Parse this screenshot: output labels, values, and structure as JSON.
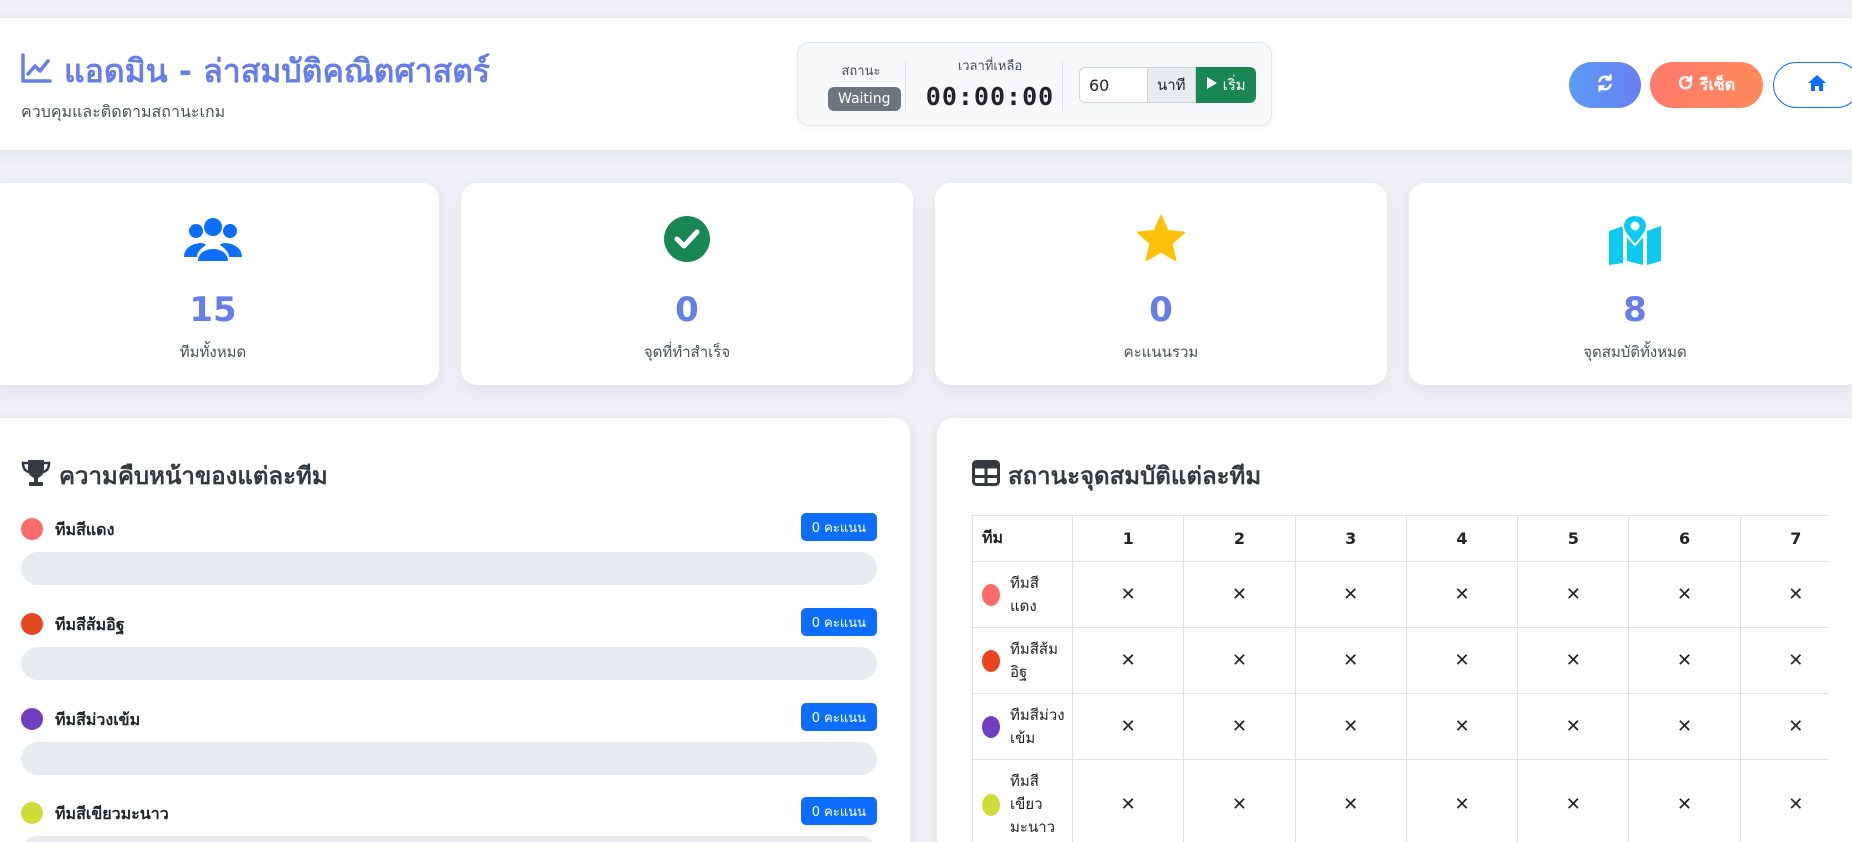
{
  "header": {
    "title": "แอดมิน - ล่าสมบัติคณิตศาสตร์",
    "subtitle": "ควบคุมและติดตามสถานะเกม",
    "status_label": "สถานะ",
    "status_value": "Waiting",
    "time_label": "เวลาที่เหลือ",
    "time_value": "00:00:00",
    "minutes_value": "60",
    "minutes_unit": "นาที",
    "start_label": "เริ่ม",
    "reset_label": "รีเซ็ต",
    "icons": {
      "title": "chart-line-icon",
      "refresh": "refresh-icon",
      "reset": "redo-icon",
      "home": "home-icon",
      "start": "play-icon"
    }
  },
  "stats": [
    {
      "icon": "users-icon",
      "value": "15",
      "label": "ทีมทั้งหมด",
      "color": "#0d6efd"
    },
    {
      "icon": "check-circle-icon",
      "value": "0",
      "label": "จุดที่ทำสำเร็จ",
      "color": "#198754"
    },
    {
      "icon": "star-icon",
      "value": "0",
      "label": "คะแนนรวม",
      "color": "#ffc107"
    },
    {
      "icon": "map-marked-icon",
      "value": "8",
      "label": "จุดสมบัติทั้งหมด",
      "color": "#0dcaf0"
    }
  ],
  "progress_panel": {
    "title": "ความคืบหน้าของแต่ละทีม",
    "icon": "trophy-icon",
    "teams": [
      {
        "name": "ทีมสีแดง",
        "color": "#ff6b6b",
        "score_label": "0 คะแนน",
        "progress": 0
      },
      {
        "name": "ทีมสีส้มอิฐ",
        "color": "#e8461e",
        "score_label": "0 คะแนน",
        "progress": 0
      },
      {
        "name": "ทีมสีม่วงเข้ม",
        "color": "#6f3fbf",
        "score_label": "0 คะแนน",
        "progress": 0
      },
      {
        "name": "ทีมสีเขียวมะนาว",
        "color": "#cddc39",
        "score_label": "0 คะแนน",
        "progress": 0
      }
    ]
  },
  "status_panel": {
    "title": "สถานะจุดสมบัติแต่ละทีม",
    "icon": "table-icon",
    "team_header": "ทีม",
    "columns": [
      "1",
      "2",
      "3",
      "4",
      "5",
      "6",
      "7"
    ],
    "mark": "✕",
    "rows": [
      {
        "name_lines": [
          "ทีมสี",
          "แดง"
        ],
        "color": "#ff6b6b"
      },
      {
        "name_lines": [
          "ทีมสีส้ม",
          "อิฐ"
        ],
        "color": "#e8461e"
      },
      {
        "name_lines": [
          "ทีมสีม่วง",
          "เข้ม"
        ],
        "color": "#6f3fbf"
      },
      {
        "name_lines": [
          "ทีมสี",
          "เขียว",
          "มะนาว"
        ],
        "color": "#cddc39"
      }
    ]
  }
}
